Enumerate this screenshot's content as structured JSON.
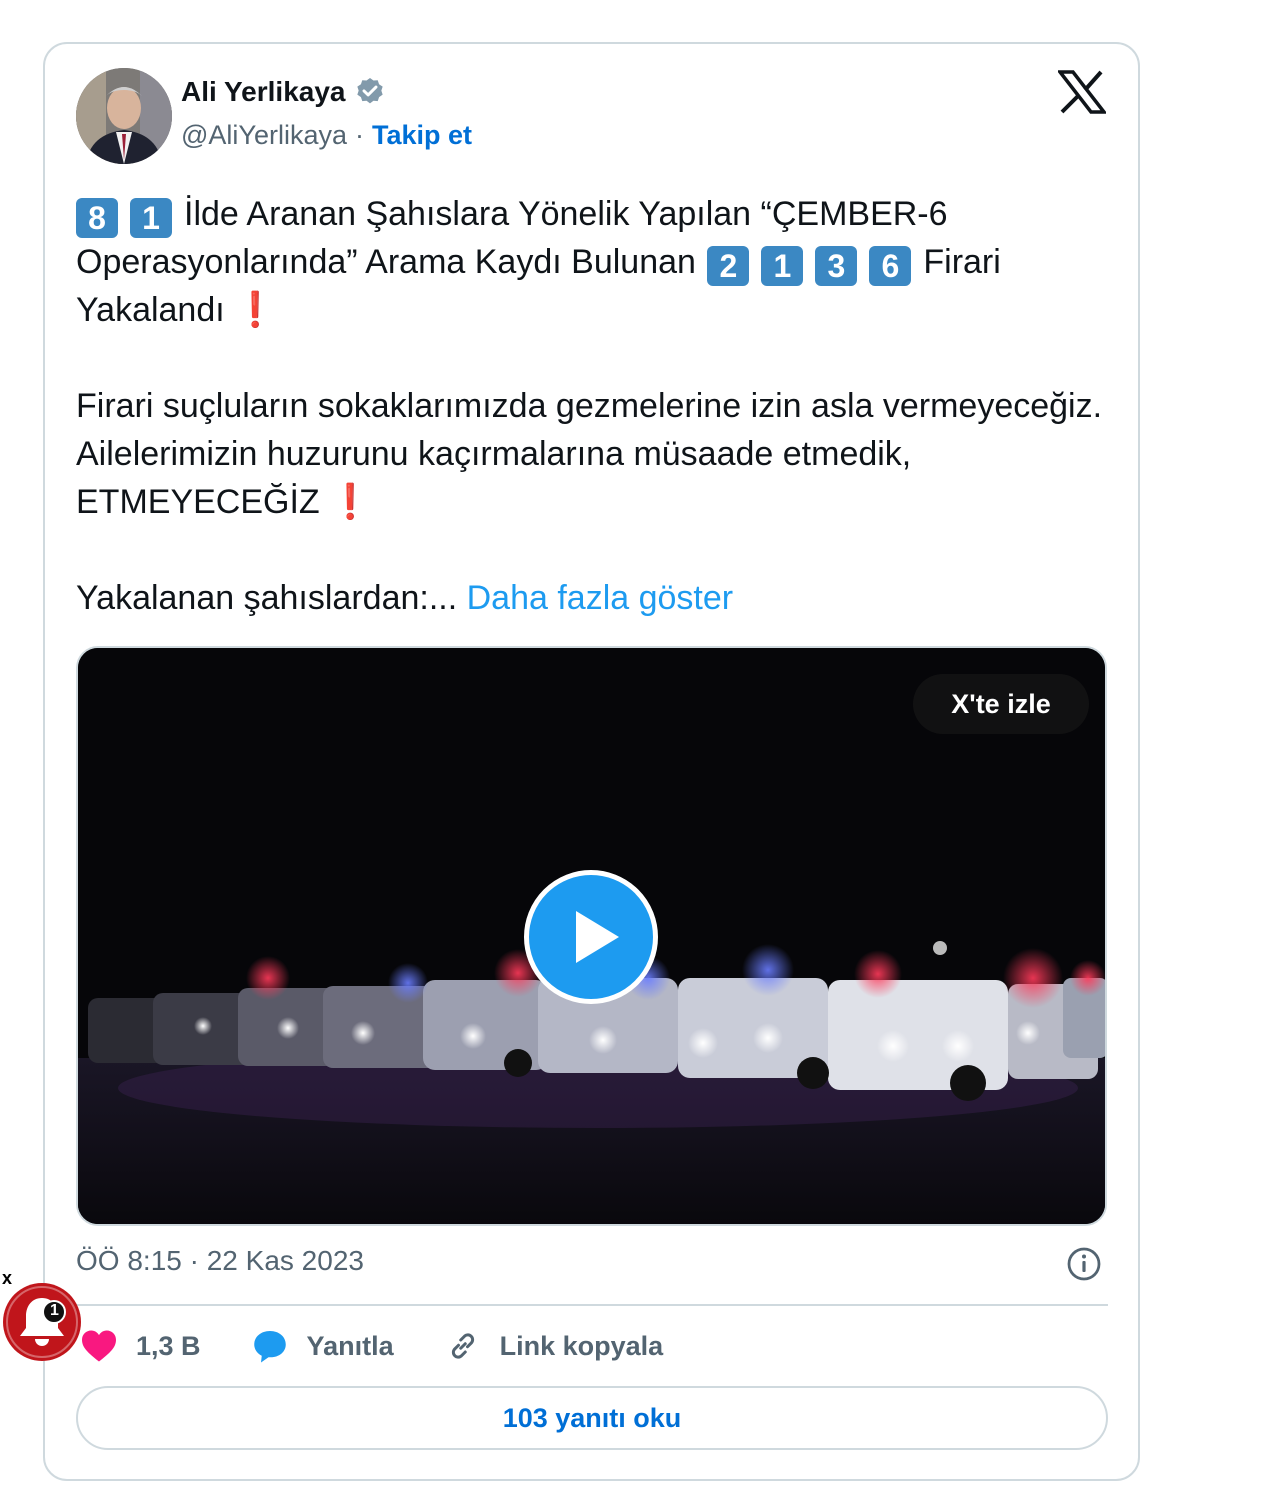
{
  "author": {
    "name": "Ali Yerlikaya",
    "handle": "@AliYerlikaya",
    "separator": "·",
    "follow_label": "Takip et"
  },
  "tweet": {
    "line1_keycaps": [
      "8",
      "1"
    ],
    "line1_text": "İlde Aranan Şahıslara Yönelik Yapılan “ÇEMBER-6 Operasyonlarında” Arama Kaydı Bulunan",
    "line1_number_keycaps": [
      "2",
      "1",
      "3",
      "6"
    ],
    "line1_tail": "Firari Yakalandı",
    "para2": "Firari suçluların sokaklarımızda gezmelerine izin asla vermeyeceğiz. Ailelerimizin huzurunu kaçırmalarına müsaade etmedik, ETMEYECEĞİZ",
    "para3": "Yakalanan şahıslardan:...",
    "show_more": "Daha fazla göster",
    "exclamation": "❗"
  },
  "media": {
    "watch_label": "X'te izle"
  },
  "timestamp": "ÖÖ 8:15 · 22 Kas 2023",
  "actions": {
    "likes": "1,3 B",
    "reply": "Yanıtla",
    "copy_link": "Link kopyala"
  },
  "read_replies": "103 yanıtı oku",
  "notification": {
    "close": "x",
    "count": "1"
  },
  "icons": [
    "verified-badge-icon",
    "x-logo-icon",
    "play-icon",
    "info-icon",
    "heart-icon",
    "reply-icon",
    "link-icon",
    "bell-icon"
  ],
  "colors": {
    "accent": "#1d9bf0",
    "link": "#006fd6",
    "heart": "#f91880",
    "keycap": "#3b88c3",
    "exclamation": "#be1931",
    "bell": "#c0151b"
  }
}
